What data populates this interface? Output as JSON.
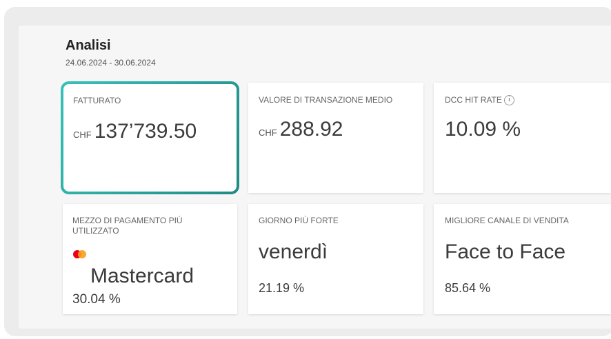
{
  "header": {
    "title": "Analisi",
    "date_range": "24.06.2024 - 30.06.2024"
  },
  "cards": {
    "revenue": {
      "label": "FATTURATO",
      "currency": "CHF",
      "value": "137’739.50"
    },
    "avg_transaction": {
      "label": "VALORE DI TRANSAZIONE MEDIO",
      "currency": "CHF",
      "value": "288.92"
    },
    "dcc_hit_rate": {
      "label": "DCC HIT RATE",
      "value": "10.09 %",
      "info_icon": "i"
    },
    "payment_method": {
      "label": "MEZZO DI PAGAMENTO PIÙ UTILIZZATO",
      "value": "Mastercard",
      "percent": "30.04 %",
      "icon": "mastercard-logo"
    },
    "strongest_day": {
      "label": "GIORNO PIÙ FORTE",
      "value": "venerdì",
      "percent": "21.19 %"
    },
    "best_channel": {
      "label": "MIGLIORE CANALE DI VENDITA",
      "value": "Face to Face",
      "percent": "85.64 %"
    }
  },
  "colors": {
    "selected_border": "#2fb0a8",
    "mastercard_red": "#eb001b",
    "mastercard_orange": "#f79e1b"
  }
}
